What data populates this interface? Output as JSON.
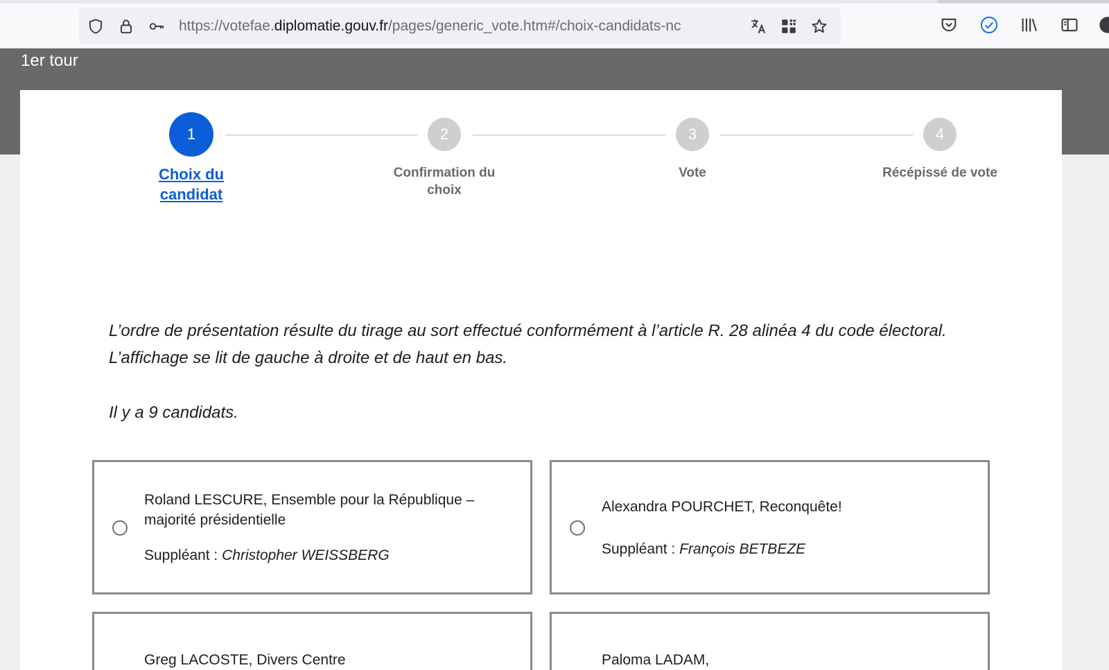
{
  "browser": {
    "url_prefix": "https://votefae.",
    "url_host": "diplomatie.gouv.fr",
    "url_path": "/pages/generic_vote.htm#/choix-candidats-nc"
  },
  "page": {
    "tour_label": "1er tour"
  },
  "stepper": {
    "steps": [
      {
        "number": "1",
        "label": "Choix du candidat"
      },
      {
        "number": "2",
        "label": "Confirmation du choix"
      },
      {
        "number": "3",
        "label": "Vote"
      },
      {
        "number": "4",
        "label": "Récépissé de vote"
      }
    ]
  },
  "info": {
    "order_text": "L’ordre de présentation résulte du tirage au sort effectué conformément à l’article R. 28 alinéa 4 du code électoral. L’affichage se lit de gauche à droite et de haut en bas.",
    "count_text": "Il y a 9 candidats."
  },
  "candidates": [
    {
      "name": "Roland LESCURE, Ensemble pour la République – majorité présidentielle",
      "substitute_label": "Suppléant :",
      "substitute": "Christopher WEISSBERG"
    },
    {
      "name": "Alexandra POURCHET, Reconquête!",
      "substitute_label": "Suppléant :",
      "substitute": "François BETBEZE"
    },
    {
      "name": "Greg LACOSTE, Divers Centre"
    },
    {
      "name": "Paloma LADAM,"
    }
  ]
}
